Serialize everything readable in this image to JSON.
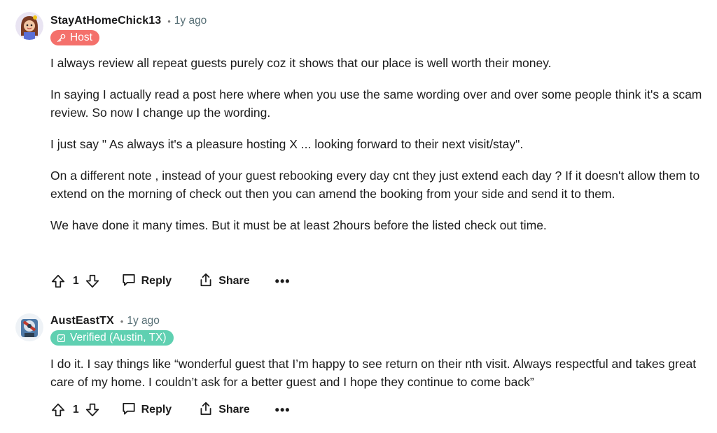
{
  "comments": [
    {
      "username": "StayAtHomeChick13",
      "separator": "•",
      "time": "1y ago",
      "flair": "Host",
      "flair_icon": "key-icon",
      "flair_color": "#f4706b",
      "paragraphs": [
        "I always review all repeat guests purely coz it shows that our place is well worth their money.",
        "In saying I actually read a post here where when you use the same wording over and over some people think it's a scam review. So now I change up the wording.",
        "I just say \" As always it's a pleasure hosting X ... looking forward to their next visit/stay\".",
        "On a different note , instead of your guest rebooking every day cnt they just extend each day ? If it doesn't allow them to extend on the morning of check out then you can amend the booking from your side and send it to them.",
        "We have done it many times. But it must be at least 2hours before the listed check out time."
      ],
      "score": "1",
      "reply_label": "Reply",
      "share_label": "Share",
      "more_label": "•••"
    },
    {
      "username": "AustEastTX",
      "separator": "•",
      "time": "1y ago",
      "flair": "Verified (Austin, TX)",
      "flair_icon": "verified-badge-icon",
      "flair_color": "#5fd0b1",
      "paragraphs": [
        "I do it. I say things like “wonderful guest that I’m happy to see return on their nth visit. Always respectful and takes great care of my home. I couldn’t ask for a better guest and I hope they continue to come back”"
      ],
      "score": "1",
      "reply_label": "Reply",
      "share_label": "Share",
      "more_label": "•••"
    }
  ]
}
